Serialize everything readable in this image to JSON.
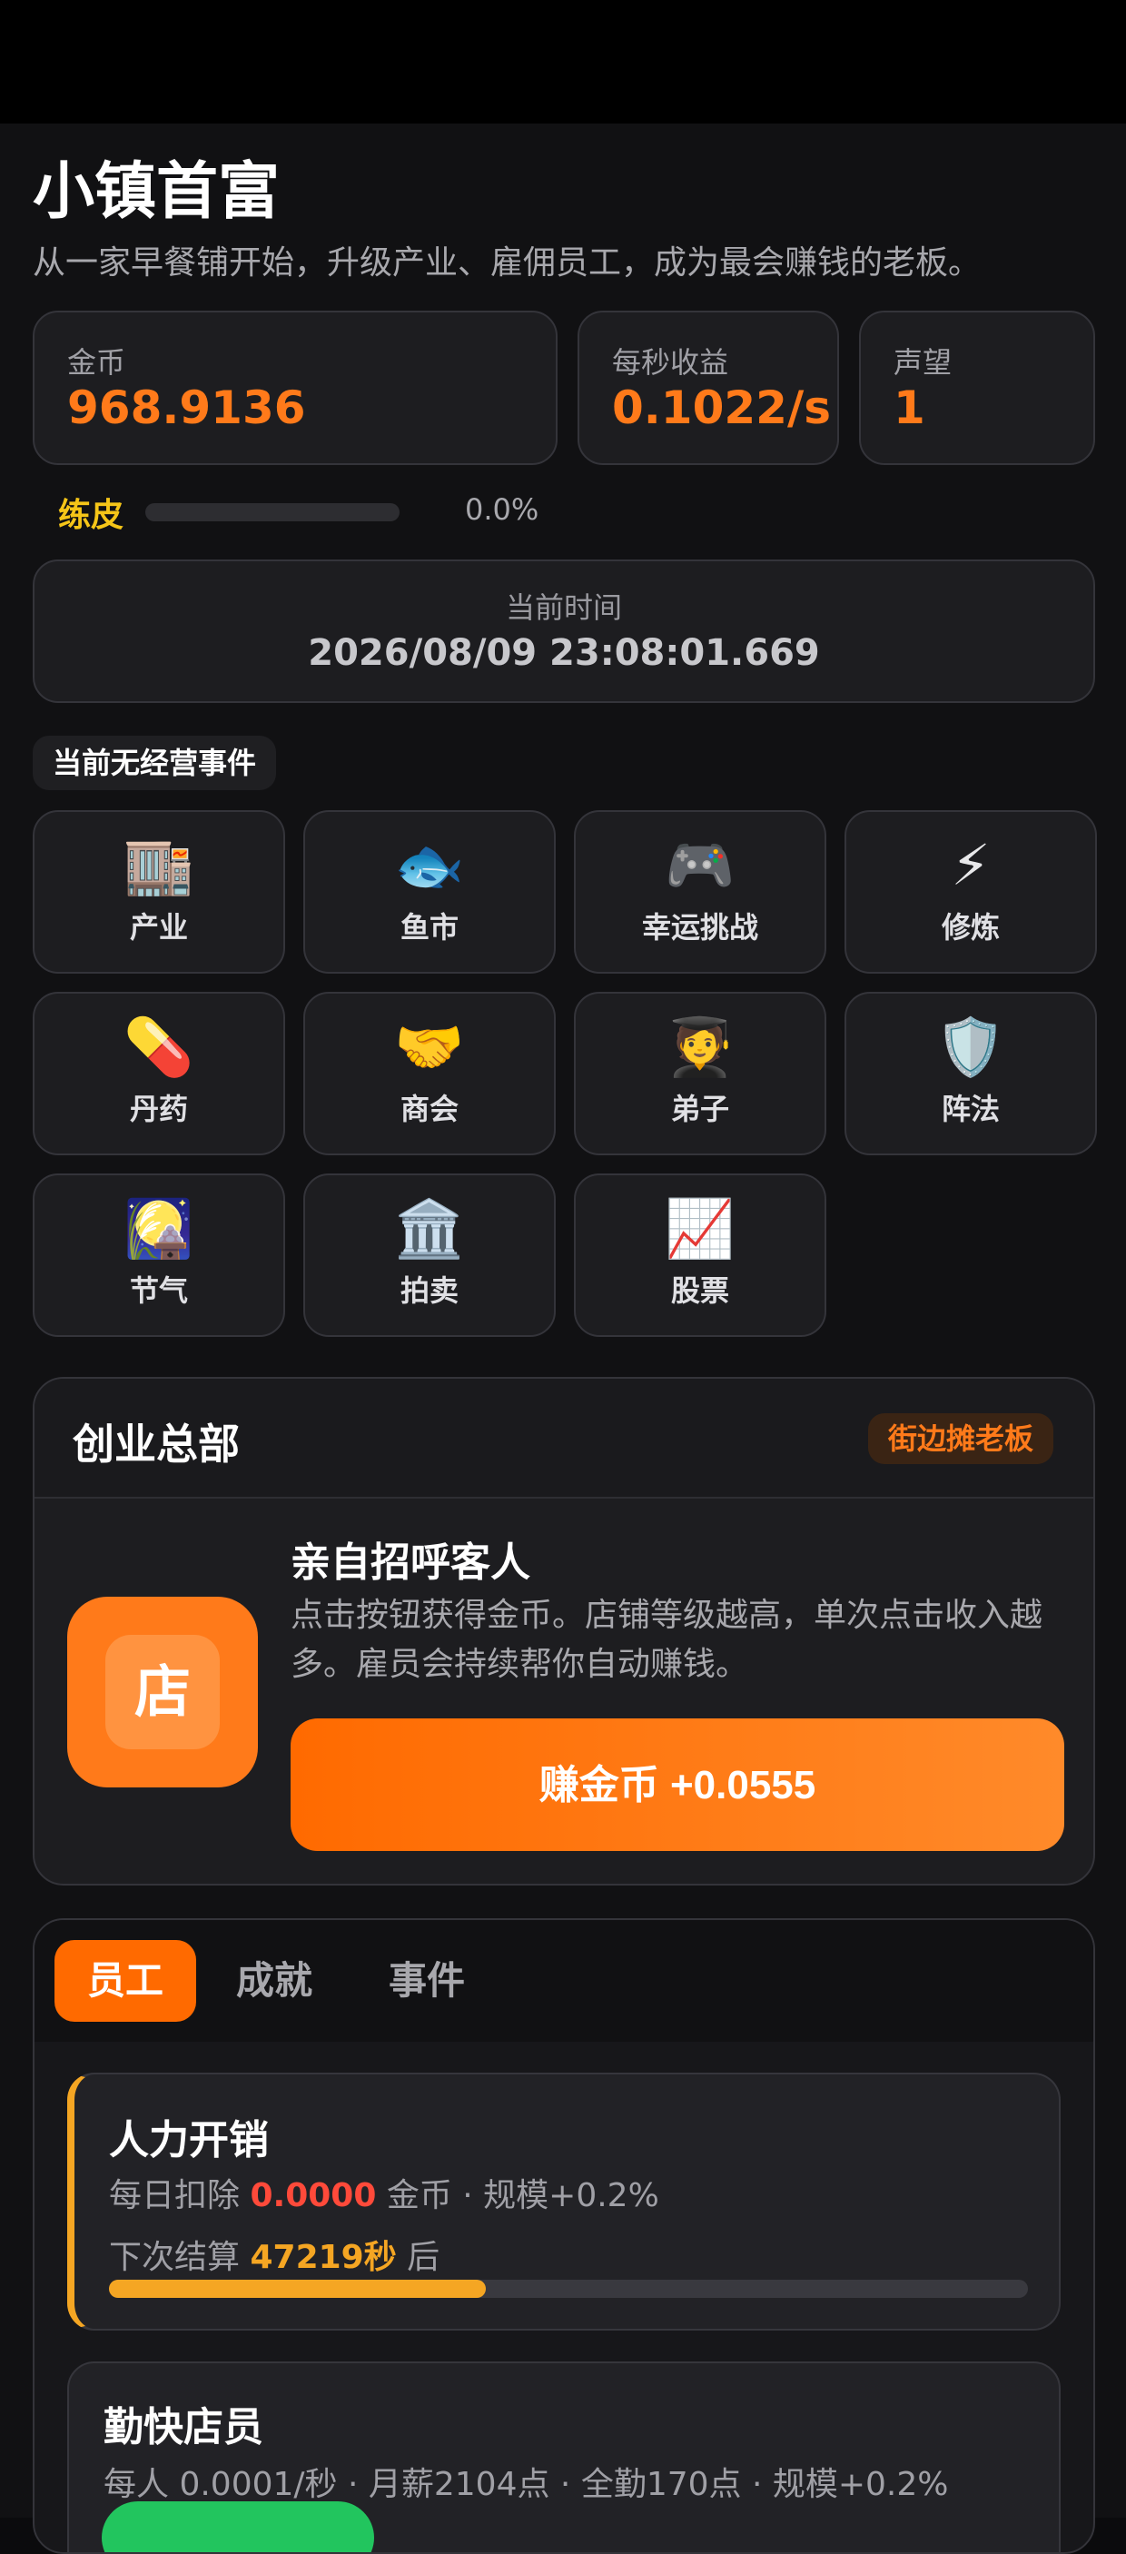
{
  "app": {
    "title": "小镇首富",
    "subtitle": "从一家早餐铺开始，升级产业、雇佣员工，成为最会赚钱的老板。"
  },
  "stats": [
    {
      "label": "金币",
      "value": "968.9136"
    },
    {
      "label": "每秒收益",
      "value": "0.1022/s"
    },
    {
      "label": "声望",
      "value": "1"
    }
  ],
  "rank": {
    "label": "练皮",
    "progress_text": "0.0%",
    "progress": 0.0
  },
  "time": {
    "label": "当前时间",
    "value": "2026/08/09 23:08:01.669"
  },
  "event_status": "当前无经营事件",
  "features": [
    {
      "label": "产业",
      "icon": "🏬",
      "icon_name": "building-icon"
    },
    {
      "label": "鱼市",
      "icon": "🐟",
      "icon_name": "fish-icon"
    },
    {
      "label": "幸运挑战",
      "icon": "🎮",
      "icon_name": "gamepad-icon"
    },
    {
      "label": "修炼",
      "icon": "⚡",
      "icon_name": "lightning-icon"
    },
    {
      "label": "丹药",
      "icon": "💊",
      "icon_name": "pill-icon"
    },
    {
      "label": "商会",
      "icon": "🤝",
      "icon_name": "handshake-icon"
    },
    {
      "label": "弟子",
      "icon": "🧑‍🎓",
      "icon_name": "student-icon"
    },
    {
      "label": "阵法",
      "icon": "🛡️",
      "icon_name": "shield-icon"
    },
    {
      "label": "节气",
      "icon": "🎑",
      "icon_name": "moon-festival-icon"
    },
    {
      "label": "拍卖",
      "icon": "🏛️",
      "icon_name": "auction-house-icon"
    },
    {
      "label": "股票",
      "icon": "📈",
      "icon_name": "stock-chart-icon"
    }
  ],
  "hq": {
    "title": "创业总部",
    "badge": "街边摊老板",
    "shop_icon_text": "店",
    "card_title": "亲自招呼客人",
    "card_desc": "点击按钮获得金币。店铺等级越高，单次点击收入越多。雇员会持续帮你自动赚钱。",
    "earn_button": "赚金币 +0.0555"
  },
  "tabs": [
    "员工",
    "成就",
    "事件"
  ],
  "labor": {
    "title": "人力开销",
    "deduct_prefix": "每日扣除",
    "deduct_value": "0.0000",
    "deduct_suffix": "金币 · 规模+0.2%",
    "next_prefix": "下次结算",
    "next_value": "47219秒",
    "next_suffix": "后",
    "progress": 0.41
  },
  "staff": {
    "title": "勤快店员",
    "desc": "每人 0.0001/秒 · 月薪2104点 · 全勤170点 · 规模+0.2%"
  },
  "colors": {
    "accent": "#ff7a1a",
    "gold": "#f5c518",
    "amber": "#f5a623",
    "danger": "#ff4a3a",
    "success": "#22c55e"
  }
}
